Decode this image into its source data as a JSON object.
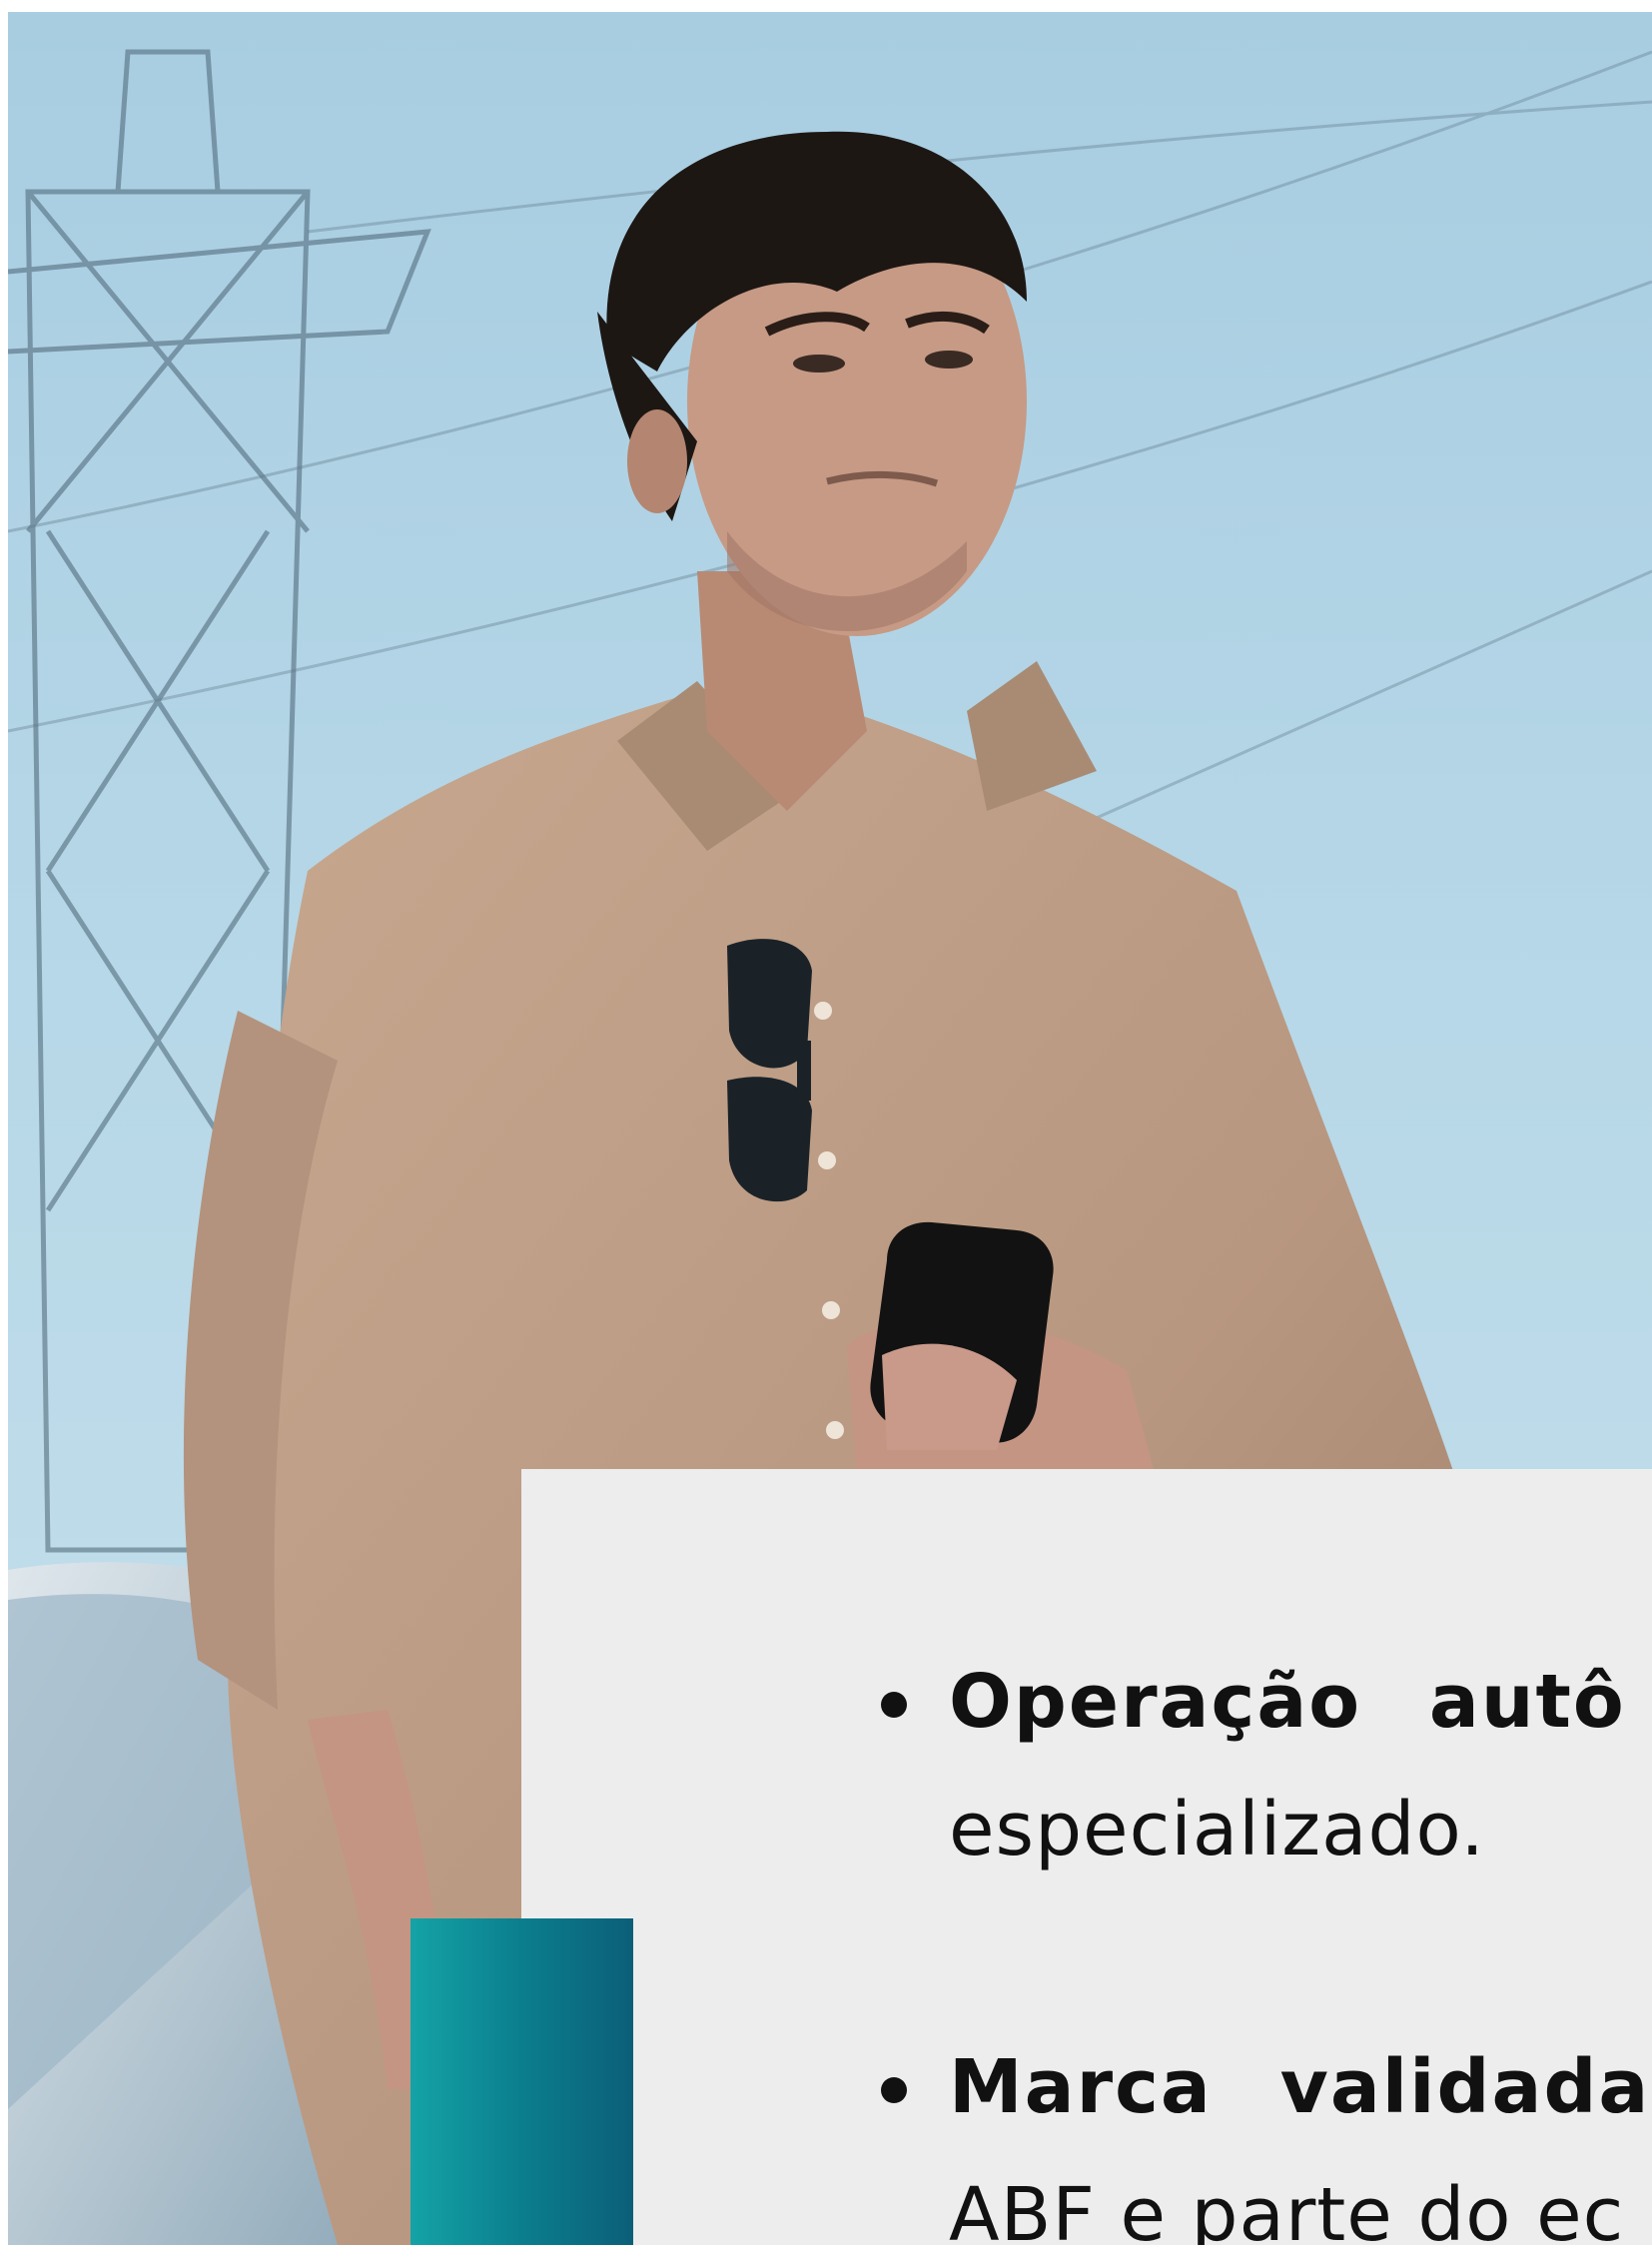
{
  "photo": {
    "subject": "man-with-phone-icon"
  },
  "bullets": [
    {
      "title": "Operação autô",
      "text": "especializado."
    },
    {
      "title": "Marca validada",
      "text": "ABF e parte do ec"
    }
  ]
}
